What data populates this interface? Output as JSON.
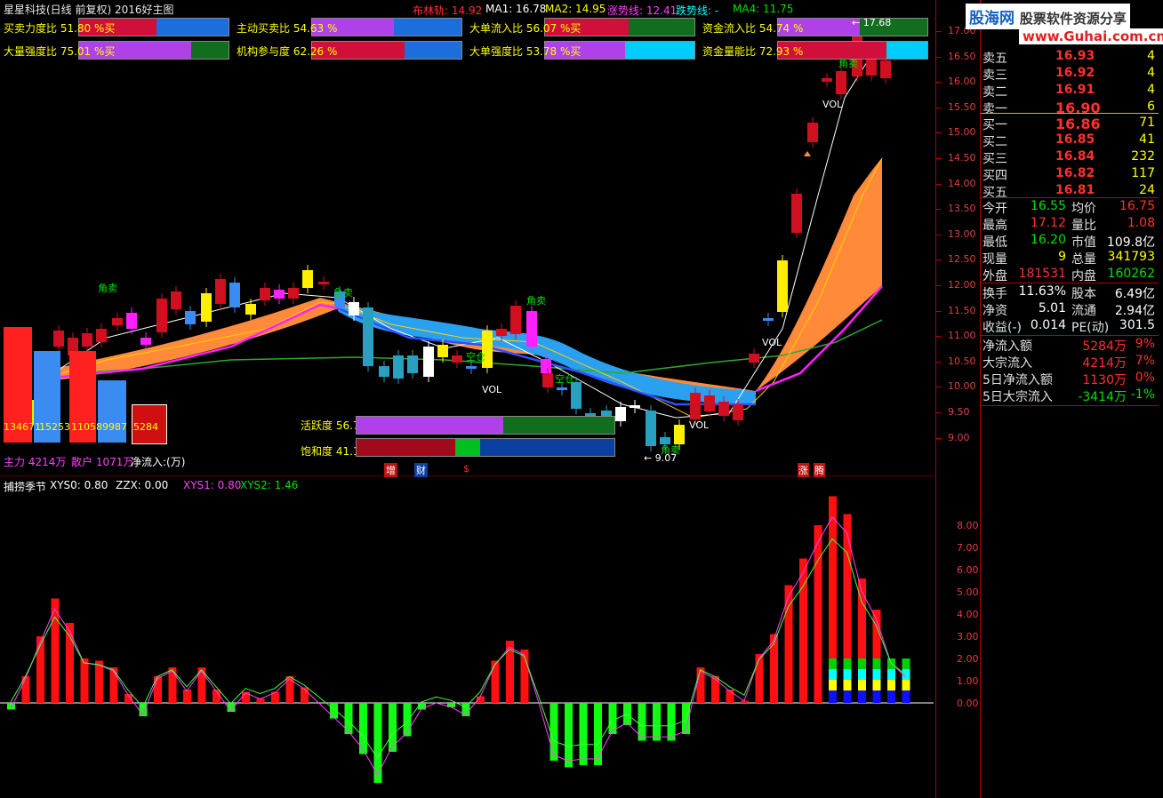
{
  "header": {
    "title": "星星科技(日线 前复权) 2016好主图",
    "boll": "布林轨: 14.92",
    "ma1": "MA1: 16.78",
    "ma2": "MA2: 14.95",
    "up_line": "涨势线: 12.41",
    "down_line": "跌势线: -",
    "ma4": "MA4: 11.75"
  },
  "indicators": [
    {
      "label": "买卖力度比 51.80 %买",
      "fill": 0.518,
      "colors": [
        "#d0103a",
        "#1a6fdc"
      ]
    },
    {
      "label": "主动买卖比 54.63 %",
      "fill": 0.546,
      "colors": [
        "#b040e8",
        "#1a6fdc"
      ]
    },
    {
      "label": "大单流入比 56.07 %买",
      "fill": 0.56,
      "colors": [
        "#d0103a",
        "#106e1e"
      ]
    },
    {
      "label": "资金流入比 54.74 %",
      "fill": 0.547,
      "colors": [
        "#b040e8",
        "#106e1e"
      ]
    },
    {
      "label": "大量强度比 75.01 %买",
      "fill": 0.75,
      "colors": [
        "#b040e8",
        "#106e1e"
      ]
    },
    {
      "label": "机构参与度 62.26 %",
      "fill": 0.622,
      "colors": [
        "#d0103a",
        "#1a6fdc"
      ]
    },
    {
      "label": "大单强度比 53.78 %买",
      "fill": 0.537,
      "colors": [
        "#b040e8",
        "#00ccff"
      ]
    },
    {
      "label": "资金量能比 72.93 %",
      "fill": 0.729,
      "colors": [
        "#d0103a",
        "#00ccff"
      ]
    }
  ],
  "activity": {
    "label": "活跃度 56.76 %",
    "fill": 0.5676
  },
  "saturation": {
    "label": "饱和度 41.14 %",
    "fill": 0.4114
  },
  "flow_bars": {
    "values": [
      "134671",
      "15253",
      "110589987",
      "5284"
    ],
    "main_label": "主力 4214万",
    "retail_label": "散户 1071万",
    "net_label": "净流入:(万)"
  },
  "chart_annotations": {
    "sell1": "角卖",
    "sell2": "角卖",
    "sell3": "角卖",
    "sell4": "角卖",
    "buy1": "急卖",
    "vol1": "VOL",
    "vol2": "VOL",
    "vol3": "VOL",
    "vol4": "VOL",
    "low_price": "9.07",
    "high_price": "17.68",
    "pos1": "空仓",
    "pos2": "空仓",
    "tag_zeng": "增",
    "tag_cai": "财",
    "tag_s": "$",
    "tag_zhang": "涨",
    "tag_teng": "腾"
  },
  "price_axis": [
    "17.00",
    "16.50",
    "16.00",
    "15.50",
    "15.00",
    "14.50",
    "14.00",
    "13.50",
    "13.00",
    "12.50",
    "12.00",
    "11.50",
    "11.00",
    "10.50",
    "10.00",
    "9.50",
    "9.00"
  ],
  "sub_header": {
    "name": "捕捞季节",
    "xys0": "XYS0: 0.80",
    "zzx": "ZZX: 0.00",
    "xys1": "XYS1: 0.80",
    "xys2": "XYS2: 1.46"
  },
  "sub_axis": [
    "8.00",
    "7.00",
    "6.00",
    "5.00",
    "4.00",
    "3.00",
    "2.00",
    "1.00",
    "0.00"
  ],
  "logo": {
    "brand": "股海网",
    "slogan": "股票软件资源分享",
    "url": "www.Guhai.com.cn"
  },
  "order_book": {
    "asks": [
      {
        "label": "卖五",
        "price": "16.93",
        "vol": "4"
      },
      {
        "label": "卖三",
        "price": "16.92",
        "vol": "4"
      },
      {
        "label": "卖二",
        "price": "16.91",
        "vol": "4"
      },
      {
        "label": "卖一",
        "price": "16.90",
        "vol": "6"
      }
    ],
    "bids": [
      {
        "label": "买一",
        "price": "16.86",
        "vol": "71"
      },
      {
        "label": "买二",
        "price": "16.85",
        "vol": "41"
      },
      {
        "label": "买三",
        "price": "16.84",
        "vol": "232"
      },
      {
        "label": "买四",
        "price": "16.82",
        "vol": "117"
      },
      {
        "label": "买五",
        "price": "16.81",
        "vol": "24"
      }
    ]
  },
  "quote": [
    {
      "l1": "今开",
      "v1": "16.55",
      "c1": "#00e000",
      "l2": "均价",
      "v2": "16.75",
      "c2": "#ff3030"
    },
    {
      "l1": "最高",
      "v1": "17.12",
      "c1": "#ff3030",
      "l2": "量比",
      "v2": "1.08",
      "c2": "#ff3030"
    },
    {
      "l1": "最低",
      "v1": "16.20",
      "c1": "#00e000",
      "l2": "市值",
      "v2": "109.8亿",
      "c2": "#ffffff"
    },
    {
      "l1": "现量",
      "v1": "9",
      "c1": "#ffff00",
      "l2": "总量",
      "v2": "341793",
      "c2": "#ffff00"
    },
    {
      "l1": "外盘",
      "v1": "181531",
      "c1": "#ff3030",
      "l2": "内盘",
      "v2": "160262",
      "c2": "#00e000"
    }
  ],
  "fundamentals": [
    {
      "l1": "换手",
      "v1": "11.63%",
      "l2": "股本",
      "v2": "6.49亿"
    },
    {
      "l1": "净资",
      "v1": "5.01",
      "l2": "流通",
      "v2": "2.94亿"
    },
    {
      "l1": "收益(-)",
      "v1": "0.014",
      "l2": "PE(动)",
      "v2": "301.5"
    }
  ],
  "flows": [
    {
      "label": "净流入额",
      "value": "5284万",
      "pct": "9%",
      "color": "#ff3030"
    },
    {
      "label": "大宗流入",
      "value": "4214万",
      "pct": "7%",
      "color": "#ff3030"
    },
    {
      "label": "5日净流入额",
      "value": "1130万",
      "pct": "0%",
      "color": "#ff3030"
    },
    {
      "label": "5日大宗流入",
      "value": "-3414万",
      "pct": "-1%",
      "color": "#00e000"
    }
  ]
}
